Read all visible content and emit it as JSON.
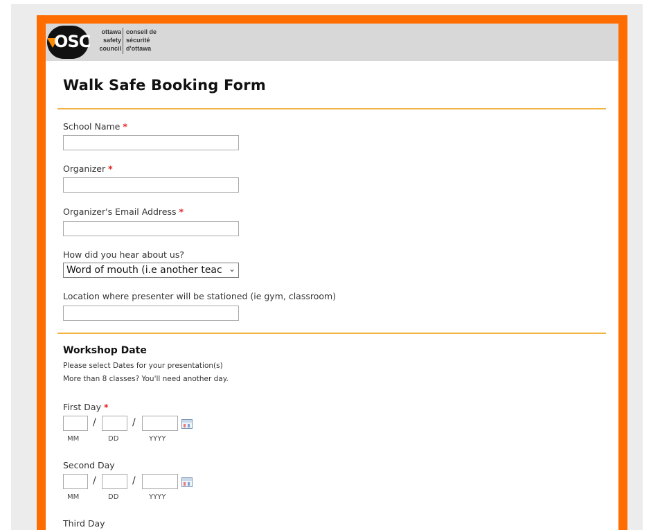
{
  "logo": {
    "mark": "OSC",
    "en_lines": [
      "ottawa",
      "safety",
      "council"
    ],
    "fr_lines": [
      "conseil de",
      "sécurité",
      "d'ottawa"
    ]
  },
  "form": {
    "title": "Walk Safe Booking Form",
    "required_mark": "*",
    "fields": {
      "school_name": {
        "label": "School Name",
        "value": ""
      },
      "organizer": {
        "label": "Organizer",
        "value": ""
      },
      "email": {
        "label": "Organizer's Email Address",
        "value": ""
      },
      "heard_about": {
        "label": "How did you hear about us?",
        "selected": "Word of mouth (i.e another teacher)"
      },
      "location": {
        "label": "Location where presenter will be stationed (ie gym, classroom)",
        "value": ""
      }
    },
    "workshop": {
      "title": "Workshop Date",
      "note1": "Please select Dates for your presentation(s)",
      "note2": "More than 8 classes? You'll need another day.",
      "date_sep": "/",
      "sub_mm": "MM",
      "sub_dd": "DD",
      "sub_yyyy": "YYYY",
      "first_day": "First Day",
      "second_day": "Second Day",
      "third_day": "Third Day"
    }
  },
  "icons": {
    "dropdown": "chevron-down-icon",
    "calendar": "calendar-icon"
  },
  "colors": {
    "frame": "#ff6d00",
    "divider": "#f2b343",
    "required": "#e32020"
  }
}
